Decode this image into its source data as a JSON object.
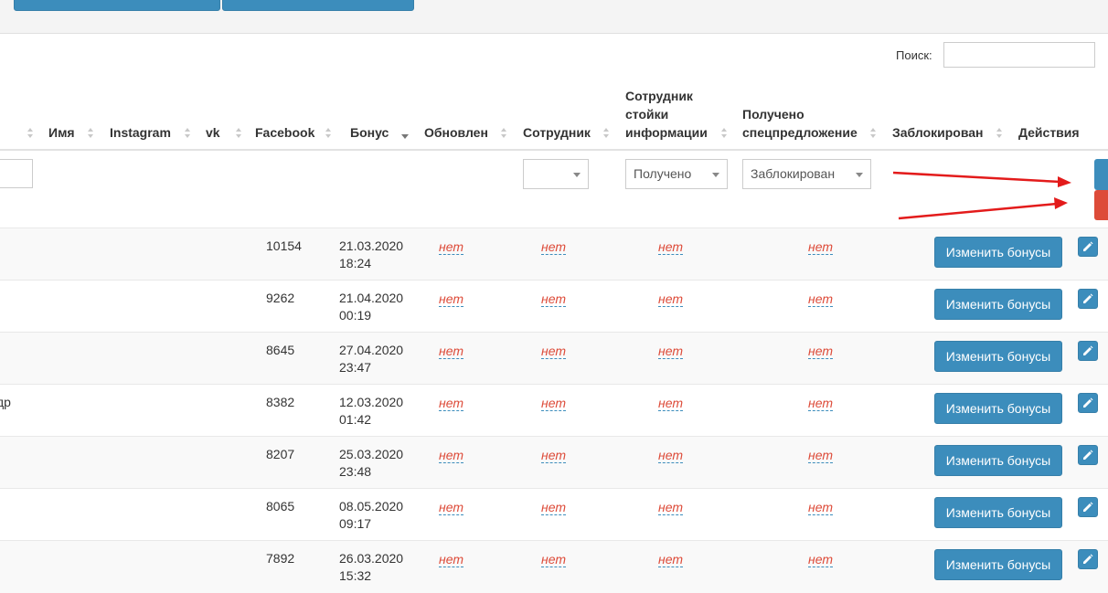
{
  "search": {
    "label": "Поиск:",
    "value": ""
  },
  "columns": [
    {
      "key": "name",
      "label": "Имя"
    },
    {
      "key": "instagram",
      "label": "Instagram"
    },
    {
      "key": "vk",
      "label": "vk"
    },
    {
      "key": "facebook",
      "label": "Facebook"
    },
    {
      "key": "bonus",
      "label": "Бонус"
    },
    {
      "key": "updated",
      "label": "Обновлен"
    },
    {
      "key": "employee",
      "label": "Сотрудник"
    },
    {
      "key": "info_desk_employee",
      "label_lines": [
        "Сотрудник",
        "стойки",
        "информации"
      ]
    },
    {
      "key": "special_offer",
      "label_lines": [
        "Получено",
        "спецпредложение"
      ]
    },
    {
      "key": "blocked",
      "label": "Заблокирован"
    },
    {
      "key": "actions",
      "label": "Действия"
    }
  ],
  "filters": {
    "employee": "",
    "info_desk_employee": "Получено",
    "special_offer": "Заблокирован"
  },
  "rows": [
    {
      "name": "",
      "bonus": "10154",
      "updated_date": "21.03.2020",
      "updated_time": "18:24",
      "employee": "нет",
      "info_desk_employee": "нет",
      "special_offer": "нет",
      "blocked": "нет",
      "action": "Изменить бонусы"
    },
    {
      "name": "",
      "bonus": "9262",
      "updated_date": "21.04.2020",
      "updated_time": "00:19",
      "employee": "нет",
      "info_desk_employee": "нет",
      "special_offer": "нет",
      "blocked": "нет",
      "action": "Изменить бонусы"
    },
    {
      "name": "",
      "bonus": "8645",
      "updated_date": "27.04.2020",
      "updated_time": "23:47",
      "employee": "нет",
      "info_desk_employee": "нет",
      "special_offer": "нет",
      "blocked": "нет",
      "action": "Изменить бонусы"
    },
    {
      "name": "др",
      "bonus": "8382",
      "updated_date": "12.03.2020",
      "updated_time": "01:42",
      "employee": "нет",
      "info_desk_employee": "нет",
      "special_offer": "нет",
      "blocked": "нет",
      "action": "Изменить бонусы"
    },
    {
      "name": "",
      "bonus": "8207",
      "updated_date": "25.03.2020",
      "updated_time": "23:48",
      "employee": "нет",
      "info_desk_employee": "нет",
      "special_offer": "нет",
      "blocked": "нет",
      "action": "Изменить бонусы"
    },
    {
      "name": "",
      "bonus": "8065",
      "updated_date": "08.05.2020",
      "updated_time": "09:17",
      "employee": "нет",
      "info_desk_employee": "нет",
      "special_offer": "нет",
      "blocked": "нет",
      "action": "Изменить бонусы"
    },
    {
      "name": "",
      "bonus": "7892",
      "updated_date": "26.03.2020",
      "updated_time": "15:32",
      "employee": "нет",
      "info_desk_employee": "нет",
      "special_offer": "нет",
      "blocked": "нет",
      "action": "Изменить бонусы"
    }
  ],
  "colors": {
    "primary": "#3c8dbc",
    "danger": "#dd4b39",
    "annotation": "#e31b1b"
  },
  "icons": {
    "edit": "pencil-icon",
    "sort": "sort-icon",
    "sort_desc": "sort-desc-icon"
  }
}
